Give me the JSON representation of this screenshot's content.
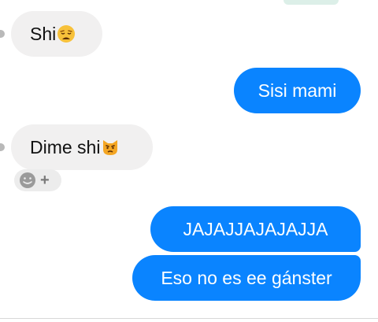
{
  "messages": [
    {
      "id": "msg1",
      "side": "incoming",
      "text": "Shi",
      "emoji": "weary-face-emoji"
    },
    {
      "id": "msg2",
      "side": "outgoing",
      "text": "Sisi mami"
    },
    {
      "id": "msg3",
      "side": "incoming",
      "text": "Dime shi",
      "emoji": "pouting-cat-emoji"
    },
    {
      "id": "msg4",
      "side": "outgoing",
      "text": "JAJAJJAJAJAJJA"
    },
    {
      "id": "msg5",
      "side": "outgoing",
      "text": "Eso no es ee gánster"
    }
  ],
  "reaction_control": {
    "icon": "smiley-icon",
    "plus": "+"
  },
  "colors": {
    "outgoing": "#0a84ff",
    "incoming": "#f1f0f0"
  }
}
